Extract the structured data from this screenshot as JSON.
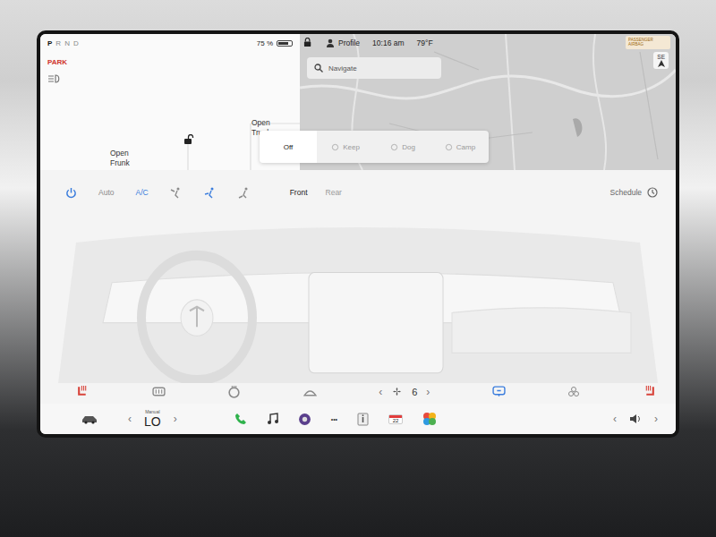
{
  "status": {
    "gears": [
      {
        "label": "P",
        "selected": true
      },
      {
        "label": "R",
        "selected": false
      },
      {
        "label": "N",
        "selected": false
      },
      {
        "label": "D",
        "selected": false
      }
    ],
    "park": "PARK",
    "battery": "75 %",
    "battery_level": 0.75
  },
  "car_panel": {
    "frunk": "Open Frunk",
    "trunk": "Open Trunk",
    "locked": false
  },
  "top_bar": {
    "profile": "Profile",
    "time": "10:16 am",
    "temperature": "79°F",
    "airbag": "PASSENGER AIRBAG",
    "compass": "SE"
  },
  "navigate": {
    "placeholder": "Navigate"
  },
  "climate_modes": [
    {
      "label": "Off",
      "selected": true
    },
    {
      "label": "Keep",
      "selected": false
    },
    {
      "label": "Dog",
      "selected": false
    },
    {
      "label": "Camp",
      "selected": false
    }
  ],
  "climate": {
    "power_on": true,
    "auto": "Auto",
    "auto_on": false,
    "ac": "A/C",
    "ac_on": true,
    "airflow": [
      {
        "selected": false
      },
      {
        "selected": true
      },
      {
        "selected": false
      }
    ],
    "zones": [
      {
        "label": "Front",
        "selected": true
      },
      {
        "label": "Rear",
        "selected": false
      }
    ],
    "schedule": "Schedule"
  },
  "controls": {
    "seat_left_on": true,
    "defrost_rear_on": false,
    "steering_heat_on": false,
    "defrost_front_on": false,
    "recirculate_on": true,
    "bioweapon_on": false,
    "seat_right_on": true
  },
  "fan": {
    "prev": "‹",
    "speed": "6",
    "next": "›"
  },
  "taskbar": {
    "temp_mode": "Manual",
    "temp": "LO",
    "prev": "‹",
    "next": "›",
    "more": "•••",
    "calendar_day": "22",
    "volume_prev": "‹",
    "volume_next": "›"
  }
}
